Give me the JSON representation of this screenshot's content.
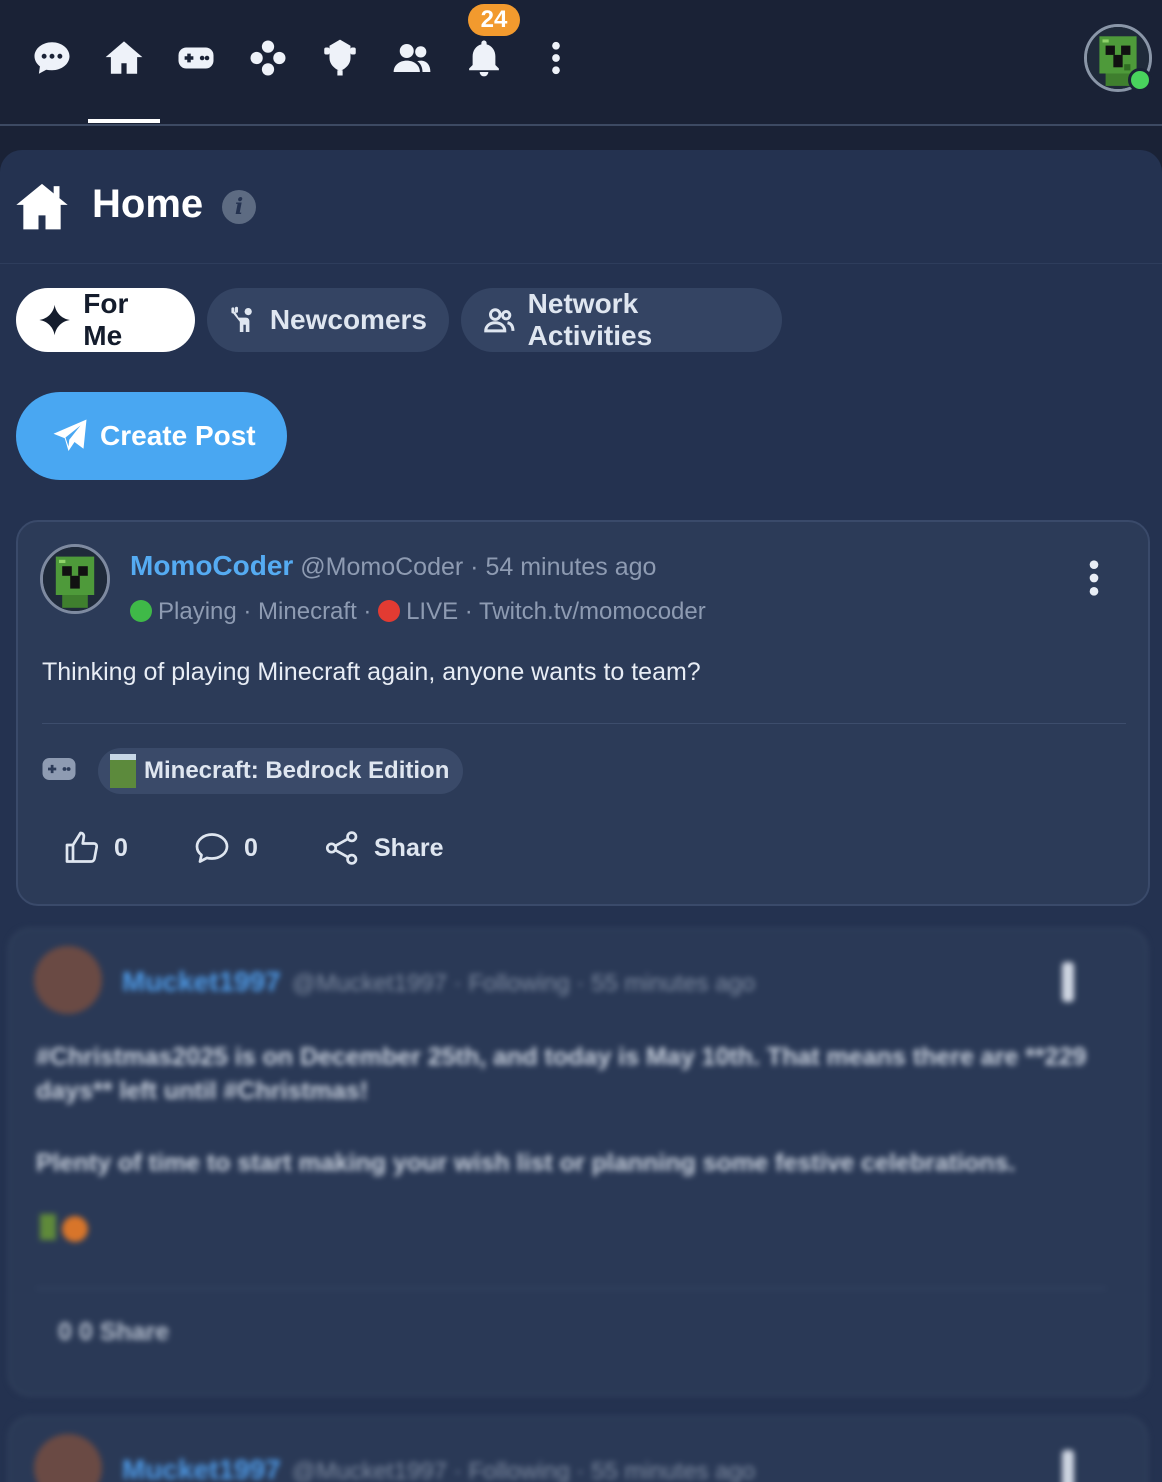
{
  "nav": {
    "icons": [
      "chat-icon",
      "home-icon",
      "gamepad-icon",
      "apps-icon",
      "trophy-icon",
      "friends-icon",
      "bell-icon",
      "more-vertical-icon"
    ],
    "notification_count": "24",
    "active": "home"
  },
  "home": {
    "title": "Home",
    "info": "i"
  },
  "tabs": [
    {
      "label": "For Me",
      "icon": "sparkle-icon",
      "active": true
    },
    {
      "label": "Newcomers",
      "icon": "wave-hand-icon",
      "active": false
    },
    {
      "label": "Network Activities",
      "icon": "friends-icon",
      "active": false
    }
  ],
  "create_post": "Create Post",
  "post": {
    "author": "MomoCoder",
    "handle": "@MomoCoder",
    "sep": "·",
    "time": "54 minutes ago",
    "status": "Playing · Minecraft ·",
    "live": "LIVE · Twitch.tv/momocoder",
    "text": "Thinking of playing Minecraft again, anyone wants to team?",
    "game": "Minecraft: Bedrock Edition",
    "likes": "0",
    "comments": "0",
    "share": "Share"
  },
  "blurred_posts": [
    {
      "author": "Mucket1997",
      "meta": "@Mucket1997 · Following · 55 minutes ago",
      "line1": "#Christmas2025 is on December 25th, and today is May 10th. That means there are **229",
      "line2": "days** left until #Christmas!",
      "line3": "Plenty of time to start making your wish list or planning some festive celebrations.",
      "actions": "0    0    Share"
    },
    {
      "author": "Mucket1997",
      "meta": "@Mucket1997 · Following · 55 minutes ago"
    }
  ],
  "colors": {
    "background": "#1a2236",
    "panel": "#243250",
    "accent": "#49a7f2",
    "badge": "#f29a2e",
    "online": "#49d35d"
  }
}
